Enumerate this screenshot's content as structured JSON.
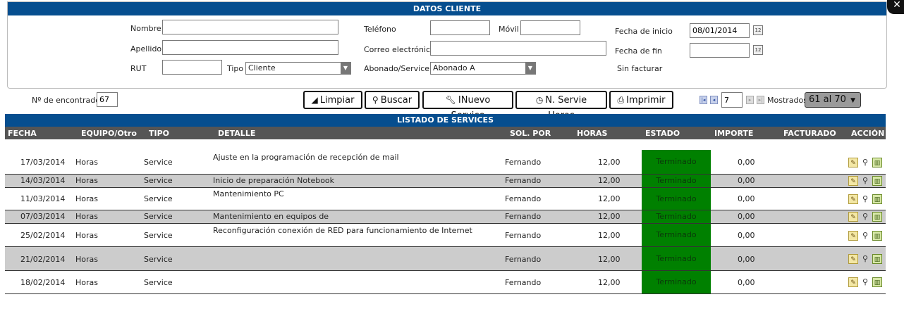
{
  "client_panel": {
    "title": "DATOS CLIENTE",
    "nombre_label": "Nombre",
    "apellido_label": "Apellido",
    "rut_label": "RUT",
    "tipo_label": "Tipo",
    "tipo_value": "Cliente",
    "telefono_label": "Teléfono",
    "movil_label": "Móvil",
    "correo_label": "Correo electrónico",
    "abonado_label": "Abonado/Service",
    "abonado_value": "Abonado A",
    "fecha_inicio_label": "Fecha de inicio",
    "fecha_inicio_value": "08/01/2014",
    "fecha_fin_label": "Fecha de fin",
    "sin_facturar_label": "Sin facturar"
  },
  "toolbar": {
    "found_label": "Nº de encontrados",
    "found_value": "67",
    "limpiar": "Limpiar",
    "buscar": "Buscar",
    "nuevo_service": "INuevo Service",
    "servie_horas": "N. Servie Horas",
    "imprimir": "Imprimir",
    "page_value": "7",
    "mostrados_label": "Mostrados",
    "shown_value": "61 al 70"
  },
  "listing": {
    "title": "LISTADO DE SERVICES",
    "headers": {
      "fecha": "FECHA",
      "equipo": "EQUIPO/Otro",
      "tipo": "TIPO",
      "detalle": "DETALLE",
      "sol_por": "SOL. POR",
      "horas": "HORAS",
      "estado": "ESTADO",
      "importe": "IMPORTE",
      "facturado": "FACTURADO",
      "accion": "ACCIÓN"
    },
    "rows": [
      {
        "fecha": "17/03/2014",
        "equipo": "Horas",
        "tipo": "Service",
        "detalle": "Ajuste en la programación de recepción de mail",
        "sol_por": "Fernando",
        "horas": "12,00",
        "estado": "Terminado",
        "importe": "0,00"
      },
      {
        "fecha": "14/03/2014",
        "equipo": "Horas",
        "tipo": "Service",
        "detalle": "Inicio de preparación Notebook",
        "sol_por": "Fernando",
        "horas": "12,00",
        "estado": "Terminado",
        "importe": "0,00"
      },
      {
        "fecha": "11/03/2014",
        "equipo": "Horas",
        "tipo": "Service",
        "detalle": "Mantenimiento PC",
        "sol_por": "Fernando",
        "horas": "12,00",
        "estado": "Terminado",
        "importe": "0,00"
      },
      {
        "fecha": "07/03/2014",
        "equipo": "Horas",
        "tipo": "Service",
        "detalle": "Mantenimiento en equipos de",
        "sol_por": "Fernando",
        "horas": "12,00",
        "estado": "Terminado",
        "importe": "0,00"
      },
      {
        "fecha": "25/02/2014",
        "equipo": "Horas",
        "tipo": "Service",
        "detalle": "Reconfiguración conexión de RED para funcionamiento de Internet",
        "sol_por": "Fernando",
        "horas": "12,00",
        "estado": "Terminado",
        "importe": "0,00"
      },
      {
        "fecha": "21/02/2014",
        "equipo": "Horas",
        "tipo": "Service",
        "detalle": "",
        "sol_por": "Fernando",
        "horas": "12,00",
        "estado": "Terminado",
        "importe": "0,00"
      },
      {
        "fecha": "18/02/2014",
        "equipo": "Horas",
        "tipo": "Service",
        "detalle": "",
        "sol_por": "Fernando",
        "horas": "12,00",
        "estado": "Terminado",
        "importe": "0,00"
      }
    ]
  },
  "icons": {
    "close": "close-icon",
    "calendar": "calendar-icon",
    "eraser": "eraser-icon",
    "search": "search-icon",
    "wrench": "wrench-icon",
    "clock": "clock-icon",
    "print": "print-icon",
    "edit": "edit-icon",
    "magnifier": "magnifier-icon",
    "trash": "trash-icon"
  },
  "colors": {
    "header_blue": "#064e8f",
    "status_green": "#008000",
    "header_gray": "#555555"
  }
}
